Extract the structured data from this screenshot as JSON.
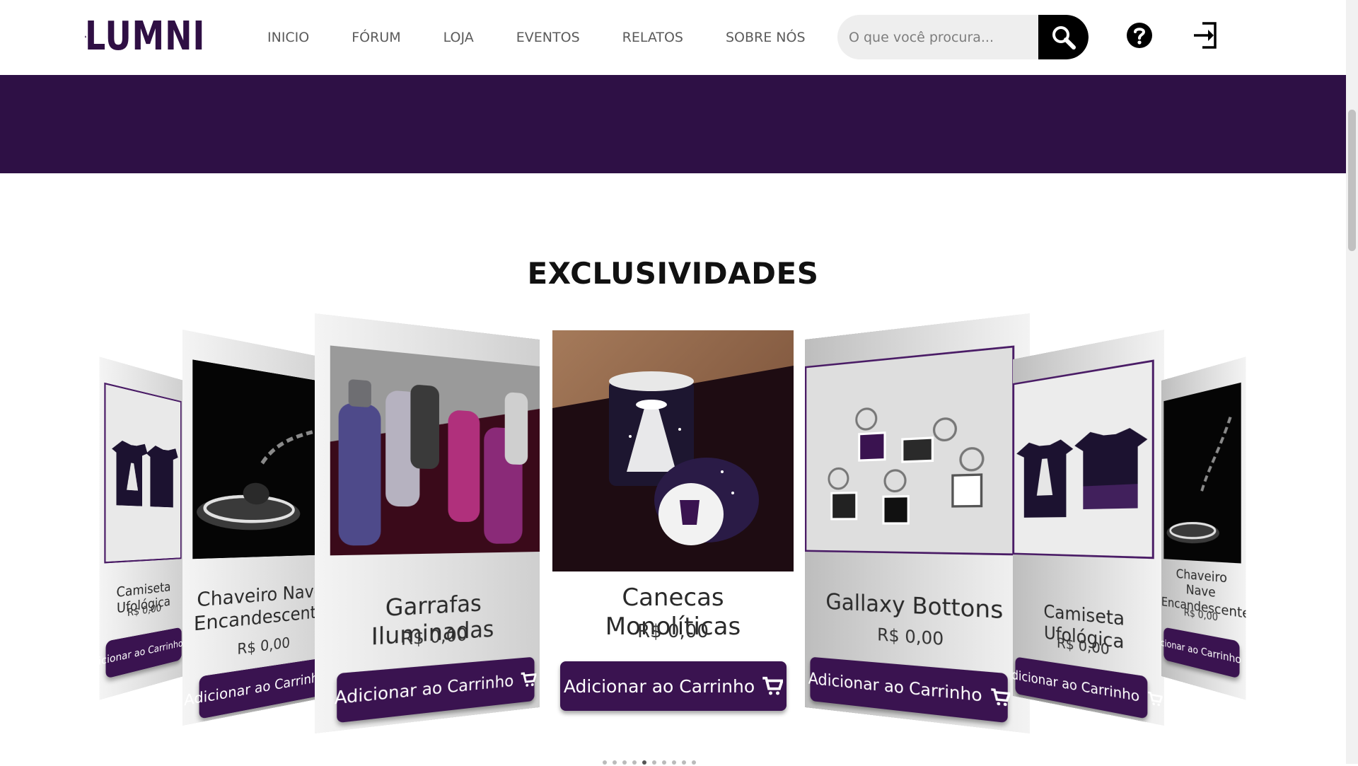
{
  "brand": {
    "name": "LUMNI"
  },
  "nav": {
    "items": [
      "INICIO",
      "FÓRUM",
      "LOJA",
      "EVENTOS",
      "RELATOS",
      "SOBRE NÓS"
    ]
  },
  "search": {
    "placeholder": "O que você procura..."
  },
  "section": {
    "title": "EXCLUSIVIDADES"
  },
  "carousel": {
    "cards": [
      {
        "name": "Camiseta Ufológica",
        "price": "R$ 0,00",
        "button": "Adicionar ao Carrinho",
        "image": "tshirt"
      },
      {
        "name": "Chaveiro Nave Encandescente",
        "price": "R$ 0,00",
        "button": "Adicionar ao Carrinho",
        "image": "keychain"
      },
      {
        "name": "Garrafas Iluminadas",
        "price": "R$ 0,00",
        "button": "Adicionar ao Carrinho",
        "image": "bottles"
      },
      {
        "name": "Canecas Monolíticas",
        "price": "R$ 0,00",
        "button": "Adicionar ao Carrinho",
        "image": "mugs"
      },
      {
        "name": "Gallaxy Bottons",
        "price": "R$ 0,00",
        "button": "Adicionar ao Carrinho",
        "image": "buttons"
      },
      {
        "name": "Camiseta Ufológica",
        "price": "R$ 0,00",
        "button": "Adicionar ao Carrinho",
        "image": "tshirt"
      },
      {
        "name": "Chaveiro Nave Encandescente",
        "price": "R$ 0,00",
        "button": "Adicionar ao Carrinho",
        "image": "keychain"
      }
    ],
    "active_index": 3,
    "dot_count": 10
  },
  "colors": {
    "brand_purple": "#2e1045",
    "button_purple": "#3a1350",
    "search_button": "#000000"
  },
  "icons": [
    "search-icon",
    "help-icon",
    "login-icon",
    "cart-icon"
  ]
}
